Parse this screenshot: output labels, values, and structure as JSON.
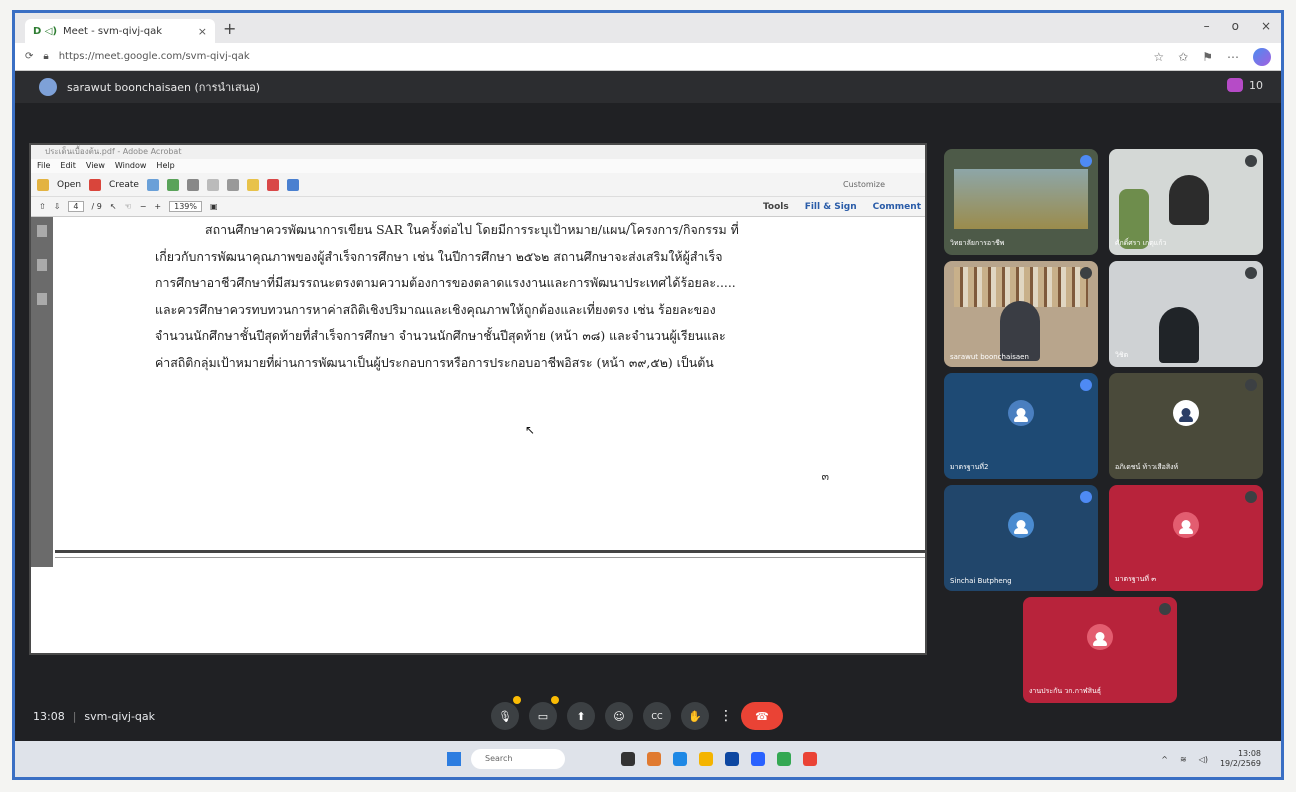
{
  "browser": {
    "tab_title": "Meet - svm-qivj-qak",
    "tab_icons": "D ◁)",
    "tab_close": "×",
    "new_tab": "+",
    "url": "https://meet.google.com/svm-qivj-qak",
    "controls": [
      "–",
      "o",
      "×"
    ]
  },
  "meet": {
    "presenter": "sarawut boonchaisaen (การนำเสนอ)",
    "participant_count": "10",
    "time": "13:08",
    "separator": "|",
    "meeting_code": "svm-qivj-qak"
  },
  "acrobat": {
    "title": "ประเด็นเบื้องต้น.pdf - Adobe Acrobat",
    "menu": [
      "File",
      "Edit",
      "View",
      "Window",
      "Help"
    ],
    "open_label": "Open",
    "create_label": "Create",
    "customize_label": "Customize",
    "page_current": "4",
    "page_total": "/ 9",
    "zoom": "139%",
    "tools": [
      "Tools",
      "Fill & Sign",
      "Comment"
    ]
  },
  "document": {
    "lines": [
      "สถานศึกษาควรพัฒนาการเขียน SAR ในครั้งต่อไป โดยมีการระบุเป้าหมาย/แผน/โครงการ/กิจกรรม ที่",
      "เกี่ยวกับการพัฒนาคุณภาพของผู้สำเร็จการศึกษา เช่น ในปีการศึกษา ๒๕๖๒ สถานศึกษาจะส่งเสริมให้ผู้สำเร็จ",
      "การศึกษาอาชีวศึกษาที่มีสมรรถนะตรงตามความต้องการของตลาดแรงงานและการพัฒนาประเทศได้ร้อยละ.....",
      "และควรศึกษาควรทบทวนการหาค่าสถิติเชิงปริมาณและเชิงคุณภาพให้ถูกต้องและเที่ยงตรง เช่น ร้อยละของ",
      "จำนวนนักศึกษาชั้นปีสุดท้ายที่สำเร็จการศึกษา จำนวนนักศึกษาชั้นปีสุดท้าย (หน้า ๓๘) และจำนวนผู้เรียนและ",
      "ค่าสถิติกลุ่มเป้าหมายที่ผ่านการพัฒนาเป็นผู้ประกอบการหรือการประกอบอาชีพอิสระ (หน้า ๓๙,๕๒) เป็นต้น"
    ],
    "page_number": "๓"
  },
  "tiles": [
    {
      "name": "วิทยาลัยการอาชีพ",
      "bg": "#4d5a48",
      "mic": "blue"
    },
    {
      "name": "ศักดิ์ศรา เกตุแก้ว",
      "bg": "#d4d8d6",
      "mic": "off"
    },
    {
      "name": "sarawut boonchaisaen",
      "bg": "#b8a58c",
      "mic": "off"
    },
    {
      "name": "วิชิต",
      "bg": "#cfd2d4",
      "mic": "off"
    },
    {
      "name": "มาตรฐานที่2",
      "bg": "#1e4a74",
      "avatar": "#4a7fc0",
      "mic": "blue"
    },
    {
      "name": "อภิเดชน์ ท้าวเสือสิงห์",
      "bg": "#4a4a3a",
      "avatar": "#ffffff",
      "mic": "off"
    },
    {
      "name": "Sinchai Butpheng",
      "bg": "#21466b",
      "avatar": "#4a8bd0",
      "mic": "blue"
    },
    {
      "name": "มาตรฐานที่ ๓",
      "bg": "#b8233b",
      "avatar": "#e35d70",
      "mic": "off"
    },
    {
      "name": "งานประกัน วก.กาฬสินธุ์",
      "bg": "#b8233b",
      "avatar": "#e35d70",
      "mic": "off"
    }
  ],
  "controls": {
    "mic_label": "🎙",
    "cam_label": "▭",
    "present_label": "⬆",
    "emoji_label": "☺",
    "cc_label": "CC",
    "hand_label": "✋",
    "more_label": "⋮",
    "end_label": "☎"
  },
  "taskbar": {
    "search_placeholder": "Search",
    "time": "13:08",
    "date": "19/2/2569"
  },
  "colors": {
    "meet_bg": "#202124",
    "accent_blue": "#3a6fc4",
    "end_call": "#ea4335"
  }
}
